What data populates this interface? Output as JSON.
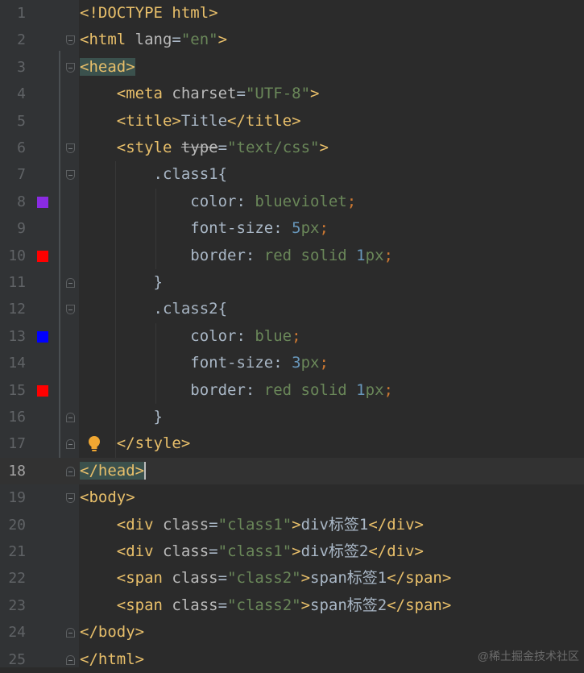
{
  "lines": [
    {
      "n": "1",
      "segs": [
        [
          "tag",
          "<!DOCTYPE html>"
        ]
      ]
    },
    {
      "n": "2",
      "segs": [
        [
          "tag",
          "<html "
        ],
        [
          "attr",
          "lang"
        ],
        [
          "plain",
          "="
        ],
        [
          "str",
          "\"en\""
        ],
        [
          "tag",
          ">"
        ]
      ]
    },
    {
      "n": "3",
      "segs": [
        [
          "tag hl",
          "<head>"
        ]
      ]
    },
    {
      "n": "4",
      "segs": [
        [
          "plain",
          "    "
        ],
        [
          "tag",
          "<meta "
        ],
        [
          "attr",
          "charset"
        ],
        [
          "plain",
          "="
        ],
        [
          "str",
          "\"UTF-8\""
        ],
        [
          "tag",
          ">"
        ]
      ]
    },
    {
      "n": "5",
      "segs": [
        [
          "plain",
          "    "
        ],
        [
          "tag",
          "<title>"
        ],
        [
          "plain",
          "Title"
        ],
        [
          "tag",
          "</title>"
        ]
      ]
    },
    {
      "n": "6",
      "segs": [
        [
          "plain",
          "    "
        ],
        [
          "tag",
          "<style "
        ],
        [
          "strike",
          "type"
        ],
        [
          "plain",
          "="
        ],
        [
          "str",
          "\"text/css\""
        ],
        [
          "tag",
          ">"
        ]
      ]
    },
    {
      "n": "7",
      "segs": [
        [
          "plain",
          "        .class1{"
        ]
      ]
    },
    {
      "n": "8",
      "segs": [
        [
          "plain",
          "            color: "
        ],
        [
          "str",
          "blueviolet"
        ],
        [
          "punct",
          ";"
        ]
      ]
    },
    {
      "n": "9",
      "segs": [
        [
          "plain",
          "            font-size: "
        ],
        [
          "num",
          "5"
        ],
        [
          "str",
          "px"
        ],
        [
          "punct",
          ";"
        ]
      ]
    },
    {
      "n": "10",
      "segs": [
        [
          "plain",
          "            border: "
        ],
        [
          "str",
          "red solid "
        ],
        [
          "num",
          "1"
        ],
        [
          "str",
          "px"
        ],
        [
          "punct",
          ";"
        ]
      ]
    },
    {
      "n": "11",
      "segs": [
        [
          "plain",
          "        }"
        ]
      ]
    },
    {
      "n": "12",
      "segs": [
        [
          "plain",
          "        .class2{"
        ]
      ]
    },
    {
      "n": "13",
      "segs": [
        [
          "plain",
          "            color: "
        ],
        [
          "str",
          "blue"
        ],
        [
          "punct",
          ";"
        ]
      ]
    },
    {
      "n": "14",
      "segs": [
        [
          "plain",
          "            font-size: "
        ],
        [
          "num",
          "3"
        ],
        [
          "str",
          "px"
        ],
        [
          "punct",
          ";"
        ]
      ]
    },
    {
      "n": "15",
      "segs": [
        [
          "plain",
          "            border: "
        ],
        [
          "str",
          "red solid "
        ],
        [
          "num",
          "1"
        ],
        [
          "str",
          "px"
        ],
        [
          "punct",
          ";"
        ]
      ]
    },
    {
      "n": "16",
      "segs": [
        [
          "plain",
          "        }"
        ]
      ]
    },
    {
      "n": "17",
      "segs": [
        [
          "plain",
          "    "
        ],
        [
          "tag",
          "</style>"
        ]
      ]
    },
    {
      "n": "18",
      "segs": [
        [
          "tag hl",
          "</head>"
        ]
      ]
    },
    {
      "n": "19",
      "segs": [
        [
          "tag",
          "<body>"
        ]
      ]
    },
    {
      "n": "20",
      "segs": [
        [
          "plain",
          "    "
        ],
        [
          "tag",
          "<div "
        ],
        [
          "attr",
          "class"
        ],
        [
          "plain",
          "="
        ],
        [
          "str",
          "\"class1\""
        ],
        [
          "tag",
          ">"
        ],
        [
          "plain",
          "div标签1"
        ],
        [
          "tag",
          "</div>"
        ]
      ]
    },
    {
      "n": "21",
      "segs": [
        [
          "plain",
          "    "
        ],
        [
          "tag",
          "<div "
        ],
        [
          "attr",
          "class"
        ],
        [
          "plain",
          "="
        ],
        [
          "str",
          "\"class1\""
        ],
        [
          "tag",
          ">"
        ],
        [
          "plain",
          "div标签2"
        ],
        [
          "tag",
          "</div>"
        ]
      ]
    },
    {
      "n": "22",
      "segs": [
        [
          "plain",
          "    "
        ],
        [
          "tag",
          "<span "
        ],
        [
          "attr",
          "class"
        ],
        [
          "plain",
          "="
        ],
        [
          "str",
          "\"class2\""
        ],
        [
          "tag",
          ">"
        ],
        [
          "plain",
          "span标签1"
        ],
        [
          "tag",
          "</span>"
        ]
      ]
    },
    {
      "n": "23",
      "segs": [
        [
          "plain",
          "    "
        ],
        [
          "tag",
          "<span "
        ],
        [
          "attr",
          "class"
        ],
        [
          "plain",
          "="
        ],
        [
          "str",
          "\"class2\""
        ],
        [
          "tag",
          ">"
        ],
        [
          "plain",
          "span标签2"
        ],
        [
          "tag",
          "</span>"
        ]
      ]
    },
    {
      "n": "24",
      "segs": [
        [
          "tag",
          "</body>"
        ]
      ]
    },
    {
      "n": "25",
      "segs": [
        [
          "tag",
          "</html>"
        ]
      ]
    }
  ],
  "swatches": {
    "8": "#8a2be2",
    "10": "#ff0000",
    "13": "#0000ff",
    "15": "#ff0000"
  },
  "folds": {
    "2": "open",
    "3": "open",
    "6": "open",
    "7": "open",
    "11": "close",
    "12": "open",
    "16": "close",
    "17": "close",
    "18": "close",
    "19": "open",
    "24": "close",
    "25": "close"
  },
  "current_line": "18",
  "intention_bulb_line": "17",
  "watermark": "@稀土掘金技术社区"
}
